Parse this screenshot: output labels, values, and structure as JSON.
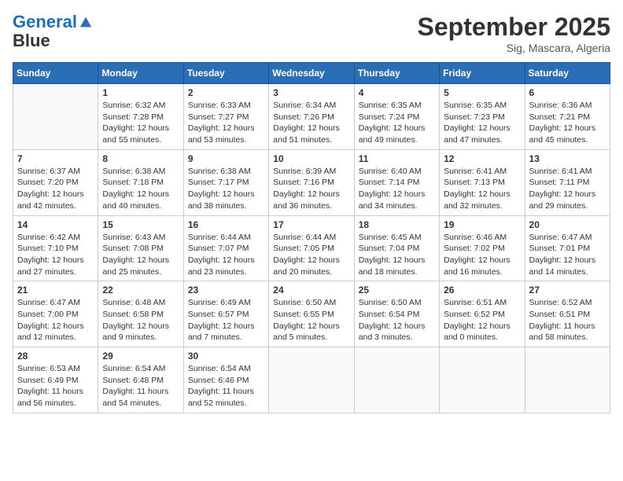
{
  "logo": {
    "line1": "General",
    "line2": "Blue"
  },
  "title": "September 2025",
  "location": "Sig, Mascara, Algeria",
  "days_of_week": [
    "Sunday",
    "Monday",
    "Tuesday",
    "Wednesday",
    "Thursday",
    "Friday",
    "Saturday"
  ],
  "weeks": [
    [
      {
        "num": "",
        "sunrise": "",
        "sunset": "",
        "daylight": ""
      },
      {
        "num": "1",
        "sunrise": "Sunrise: 6:32 AM",
        "sunset": "Sunset: 7:28 PM",
        "daylight": "Daylight: 12 hours and 55 minutes."
      },
      {
        "num": "2",
        "sunrise": "Sunrise: 6:33 AM",
        "sunset": "Sunset: 7:27 PM",
        "daylight": "Daylight: 12 hours and 53 minutes."
      },
      {
        "num": "3",
        "sunrise": "Sunrise: 6:34 AM",
        "sunset": "Sunset: 7:26 PM",
        "daylight": "Daylight: 12 hours and 51 minutes."
      },
      {
        "num": "4",
        "sunrise": "Sunrise: 6:35 AM",
        "sunset": "Sunset: 7:24 PM",
        "daylight": "Daylight: 12 hours and 49 minutes."
      },
      {
        "num": "5",
        "sunrise": "Sunrise: 6:35 AM",
        "sunset": "Sunset: 7:23 PM",
        "daylight": "Daylight: 12 hours and 47 minutes."
      },
      {
        "num": "6",
        "sunrise": "Sunrise: 6:36 AM",
        "sunset": "Sunset: 7:21 PM",
        "daylight": "Daylight: 12 hours and 45 minutes."
      }
    ],
    [
      {
        "num": "7",
        "sunrise": "Sunrise: 6:37 AM",
        "sunset": "Sunset: 7:20 PM",
        "daylight": "Daylight: 12 hours and 42 minutes."
      },
      {
        "num": "8",
        "sunrise": "Sunrise: 6:38 AM",
        "sunset": "Sunset: 7:18 PM",
        "daylight": "Daylight: 12 hours and 40 minutes."
      },
      {
        "num": "9",
        "sunrise": "Sunrise: 6:38 AM",
        "sunset": "Sunset: 7:17 PM",
        "daylight": "Daylight: 12 hours and 38 minutes."
      },
      {
        "num": "10",
        "sunrise": "Sunrise: 6:39 AM",
        "sunset": "Sunset: 7:16 PM",
        "daylight": "Daylight: 12 hours and 36 minutes."
      },
      {
        "num": "11",
        "sunrise": "Sunrise: 6:40 AM",
        "sunset": "Sunset: 7:14 PM",
        "daylight": "Daylight: 12 hours and 34 minutes."
      },
      {
        "num": "12",
        "sunrise": "Sunrise: 6:41 AM",
        "sunset": "Sunset: 7:13 PM",
        "daylight": "Daylight: 12 hours and 32 minutes."
      },
      {
        "num": "13",
        "sunrise": "Sunrise: 6:41 AM",
        "sunset": "Sunset: 7:11 PM",
        "daylight": "Daylight: 12 hours and 29 minutes."
      }
    ],
    [
      {
        "num": "14",
        "sunrise": "Sunrise: 6:42 AM",
        "sunset": "Sunset: 7:10 PM",
        "daylight": "Daylight: 12 hours and 27 minutes."
      },
      {
        "num": "15",
        "sunrise": "Sunrise: 6:43 AM",
        "sunset": "Sunset: 7:08 PM",
        "daylight": "Daylight: 12 hours and 25 minutes."
      },
      {
        "num": "16",
        "sunrise": "Sunrise: 6:44 AM",
        "sunset": "Sunset: 7:07 PM",
        "daylight": "Daylight: 12 hours and 23 minutes."
      },
      {
        "num": "17",
        "sunrise": "Sunrise: 6:44 AM",
        "sunset": "Sunset: 7:05 PM",
        "daylight": "Daylight: 12 hours and 20 minutes."
      },
      {
        "num": "18",
        "sunrise": "Sunrise: 6:45 AM",
        "sunset": "Sunset: 7:04 PM",
        "daylight": "Daylight: 12 hours and 18 minutes."
      },
      {
        "num": "19",
        "sunrise": "Sunrise: 6:46 AM",
        "sunset": "Sunset: 7:02 PM",
        "daylight": "Daylight: 12 hours and 16 minutes."
      },
      {
        "num": "20",
        "sunrise": "Sunrise: 6:47 AM",
        "sunset": "Sunset: 7:01 PM",
        "daylight": "Daylight: 12 hours and 14 minutes."
      }
    ],
    [
      {
        "num": "21",
        "sunrise": "Sunrise: 6:47 AM",
        "sunset": "Sunset: 7:00 PM",
        "daylight": "Daylight: 12 hours and 12 minutes."
      },
      {
        "num": "22",
        "sunrise": "Sunrise: 6:48 AM",
        "sunset": "Sunset: 6:58 PM",
        "daylight": "Daylight: 12 hours and 9 minutes."
      },
      {
        "num": "23",
        "sunrise": "Sunrise: 6:49 AM",
        "sunset": "Sunset: 6:57 PM",
        "daylight": "Daylight: 12 hours and 7 minutes."
      },
      {
        "num": "24",
        "sunrise": "Sunrise: 6:50 AM",
        "sunset": "Sunset: 6:55 PM",
        "daylight": "Daylight: 12 hours and 5 minutes."
      },
      {
        "num": "25",
        "sunrise": "Sunrise: 6:50 AM",
        "sunset": "Sunset: 6:54 PM",
        "daylight": "Daylight: 12 hours and 3 minutes."
      },
      {
        "num": "26",
        "sunrise": "Sunrise: 6:51 AM",
        "sunset": "Sunset: 6:52 PM",
        "daylight": "Daylight: 12 hours and 0 minutes."
      },
      {
        "num": "27",
        "sunrise": "Sunrise: 6:52 AM",
        "sunset": "Sunset: 6:51 PM",
        "daylight": "Daylight: 11 hours and 58 minutes."
      }
    ],
    [
      {
        "num": "28",
        "sunrise": "Sunrise: 6:53 AM",
        "sunset": "Sunset: 6:49 PM",
        "daylight": "Daylight: 11 hours and 56 minutes."
      },
      {
        "num": "29",
        "sunrise": "Sunrise: 6:54 AM",
        "sunset": "Sunset: 6:48 PM",
        "daylight": "Daylight: 11 hours and 54 minutes."
      },
      {
        "num": "30",
        "sunrise": "Sunrise: 6:54 AM",
        "sunset": "Sunset: 6:46 PM",
        "daylight": "Daylight: 11 hours and 52 minutes."
      },
      {
        "num": "",
        "sunrise": "",
        "sunset": "",
        "daylight": ""
      },
      {
        "num": "",
        "sunrise": "",
        "sunset": "",
        "daylight": ""
      },
      {
        "num": "",
        "sunrise": "",
        "sunset": "",
        "daylight": ""
      },
      {
        "num": "",
        "sunrise": "",
        "sunset": "",
        "daylight": ""
      }
    ]
  ]
}
